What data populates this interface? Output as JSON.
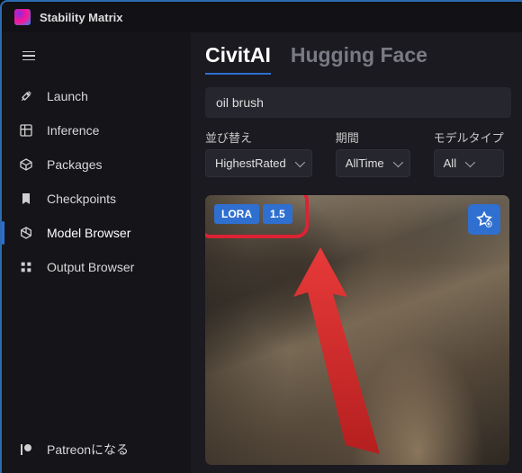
{
  "app": {
    "title": "Stability Matrix"
  },
  "sidebar": {
    "items": [
      {
        "label": "Launch"
      },
      {
        "label": "Inference"
      },
      {
        "label": "Packages"
      },
      {
        "label": "Checkpoints"
      },
      {
        "label": "Model Browser"
      },
      {
        "label": "Output Browser"
      }
    ],
    "footer": {
      "label": "Patreonになる"
    }
  },
  "tabs": {
    "civitai": "CivitAI",
    "hf": "Hugging Face"
  },
  "search": {
    "value": "oil brush"
  },
  "filters": {
    "sort": {
      "label": "並び替え",
      "value": "HighestRated"
    },
    "period": {
      "label": "期間",
      "value": "AllTime"
    },
    "type": {
      "label": "モデルタイプ",
      "value": "All"
    }
  },
  "card": {
    "badges": {
      "kind": "LORA",
      "ver": "1.5"
    }
  }
}
